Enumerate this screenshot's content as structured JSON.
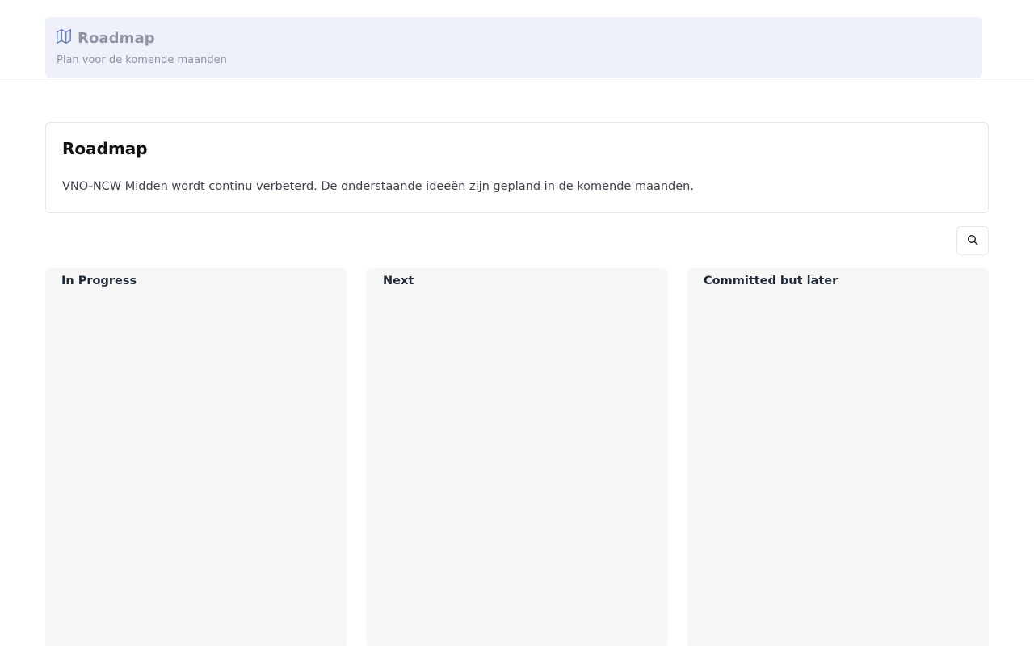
{
  "header": {
    "title": "Roadmap",
    "subtitle": "Plan voor de komende maanden",
    "icon": "map-icon",
    "background_color": "#eef1f9",
    "text_color": "#8e93a6"
  },
  "intro": {
    "title": "Roadmap",
    "description": "VNO-NCW Midden wordt continu verbeterd. De onderstaande ideeën zijn gepland in de komende maanden."
  },
  "toolbar": {
    "search_icon": "search-icon"
  },
  "columns": [
    {
      "title": "In Progress"
    },
    {
      "title": "Next"
    },
    {
      "title": "Committed but later"
    }
  ]
}
